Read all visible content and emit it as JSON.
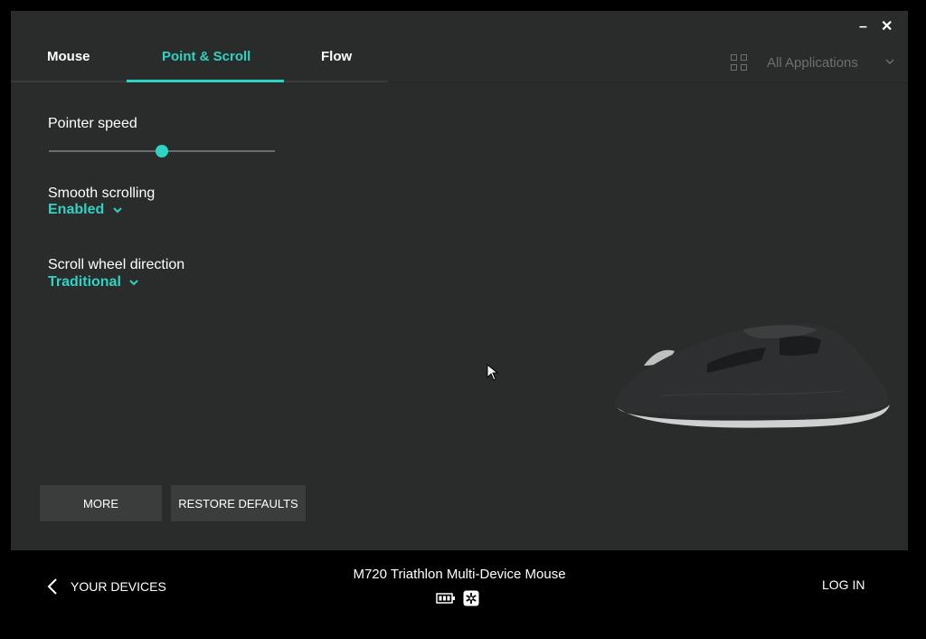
{
  "window": {
    "minimize_glyph": "–",
    "close_glyph": "✕"
  },
  "tabs": [
    {
      "label": "Mouse",
      "active": false
    },
    {
      "label": "Point & Scroll",
      "active": true
    },
    {
      "label": "Flow",
      "active": false
    }
  ],
  "app_selector": {
    "label": "All Applications",
    "icon": "grid-icon"
  },
  "settings": {
    "pointer_speed": {
      "label": "Pointer speed",
      "value_fraction": 0.5
    },
    "smooth_scrolling": {
      "label": "Smooth scrolling",
      "value": "Enabled"
    },
    "scroll_direction": {
      "label": "Scroll wheel direction",
      "value": "Traditional"
    }
  },
  "buttons": {
    "more": "MORE",
    "restore": "RESTORE DEFAULTS"
  },
  "footer": {
    "back_label": "YOUR DEVICES",
    "device_name": "M720 Triathlon Multi-Device Mouse",
    "login_label": "LOG IN"
  },
  "colors": {
    "accent": "#2fd3c3",
    "background": "#2a2b2b"
  }
}
